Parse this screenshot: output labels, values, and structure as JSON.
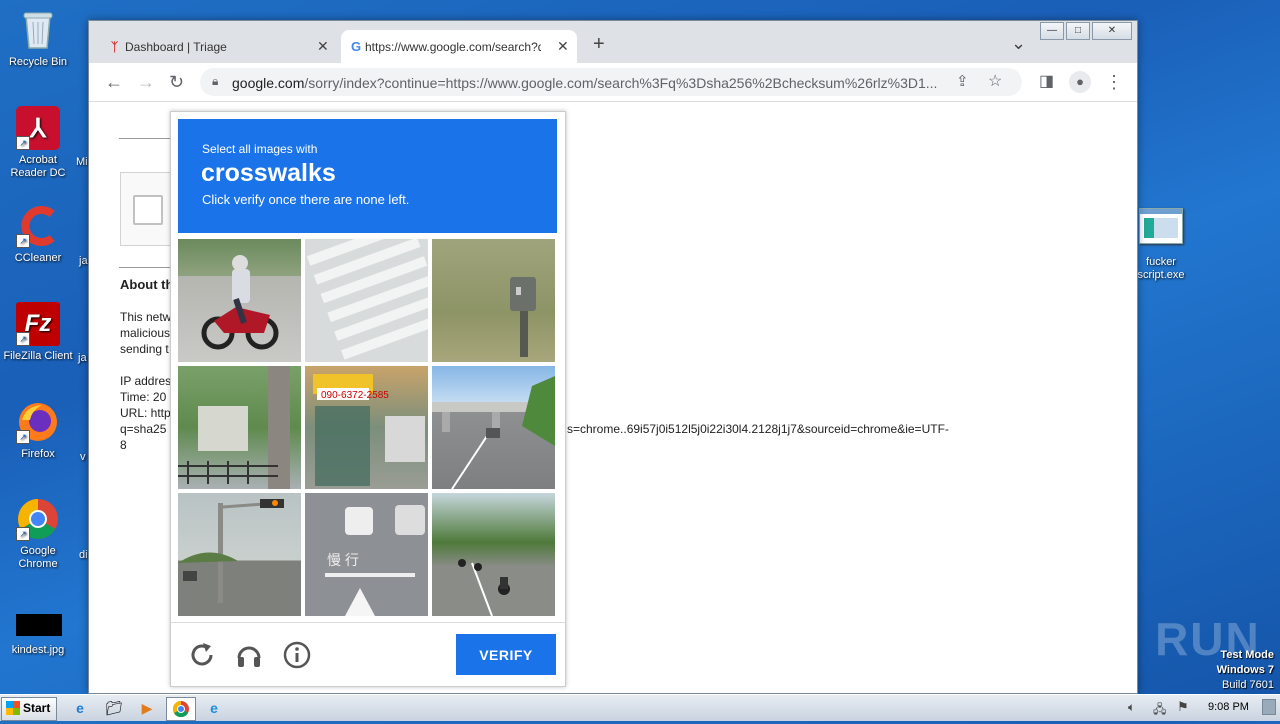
{
  "desktop": {
    "icons": [
      {
        "label": "Recycle Bin",
        "icon": "recycle-bin-icon"
      },
      {
        "label": "Acrobat Reader DC",
        "icon": "acrobat-icon"
      },
      {
        "label": "CCleaner",
        "icon": "ccleaner-icon"
      },
      {
        "label": "FileZilla Client",
        "icon": "filezilla-icon"
      },
      {
        "label": "Firefox",
        "icon": "firefox-icon"
      },
      {
        "label": "Google Chrome",
        "icon": "chrome-icon"
      },
      {
        "label": "kindest.jpg",
        "icon": "image-file-icon"
      }
    ],
    "right_icon": {
      "label": "fucker script.exe",
      "icon": "exe-file-icon"
    },
    "partial_labels": [
      "Mi",
      "ja",
      "ja",
      "v",
      "di"
    ],
    "watermark": "ANY RUN",
    "os_info": {
      "line1": "Test Mode",
      "line2": "Windows 7",
      "line3": "Build 7601"
    }
  },
  "browser": {
    "tabs": [
      {
        "title": "Dashboard | Triage",
        "close": "✕"
      },
      {
        "title": "https://www.google.com/search?q=",
        "close": "✕"
      }
    ],
    "new_tab": "+",
    "tab_menu": "⌄",
    "window_controls": {
      "minimize": "—",
      "maximize": "□",
      "close": "✕"
    },
    "address": {
      "host": "google.com",
      "path": "/sorry/index?continue=https://www.google.com/search%3Fq%3Dsha256%2Bchecksum%26rlz%3D1..."
    }
  },
  "page": {
    "about": "About th",
    "para": [
      "This netw",
      "malicious",
      "sending t"
    ],
    "info": [
      "IP addres",
      "Time: 20",
      "URL: http",
      "q=sha25"
    ],
    "url_tail": "s=chrome..69i57j0i512l5j0i22i30l4.2128j1j7&sourceid=chrome&ie=UTF-",
    "url_tail2": "8"
  },
  "captcha": {
    "instruction": "Select all images with",
    "target": "crosswalks",
    "sub": "Click verify once there are none left.",
    "verify_label": "VERIFY",
    "tiles": [
      "motorcycle rider",
      "crosswalk stripes",
      "roadside post",
      "tree and fence",
      "shop signs",
      "highway overpass",
      "traffic light pole",
      "road markings",
      "road with motorcycles"
    ]
  },
  "taskbar": {
    "start_label": "Start",
    "time": "9:08 PM"
  }
}
